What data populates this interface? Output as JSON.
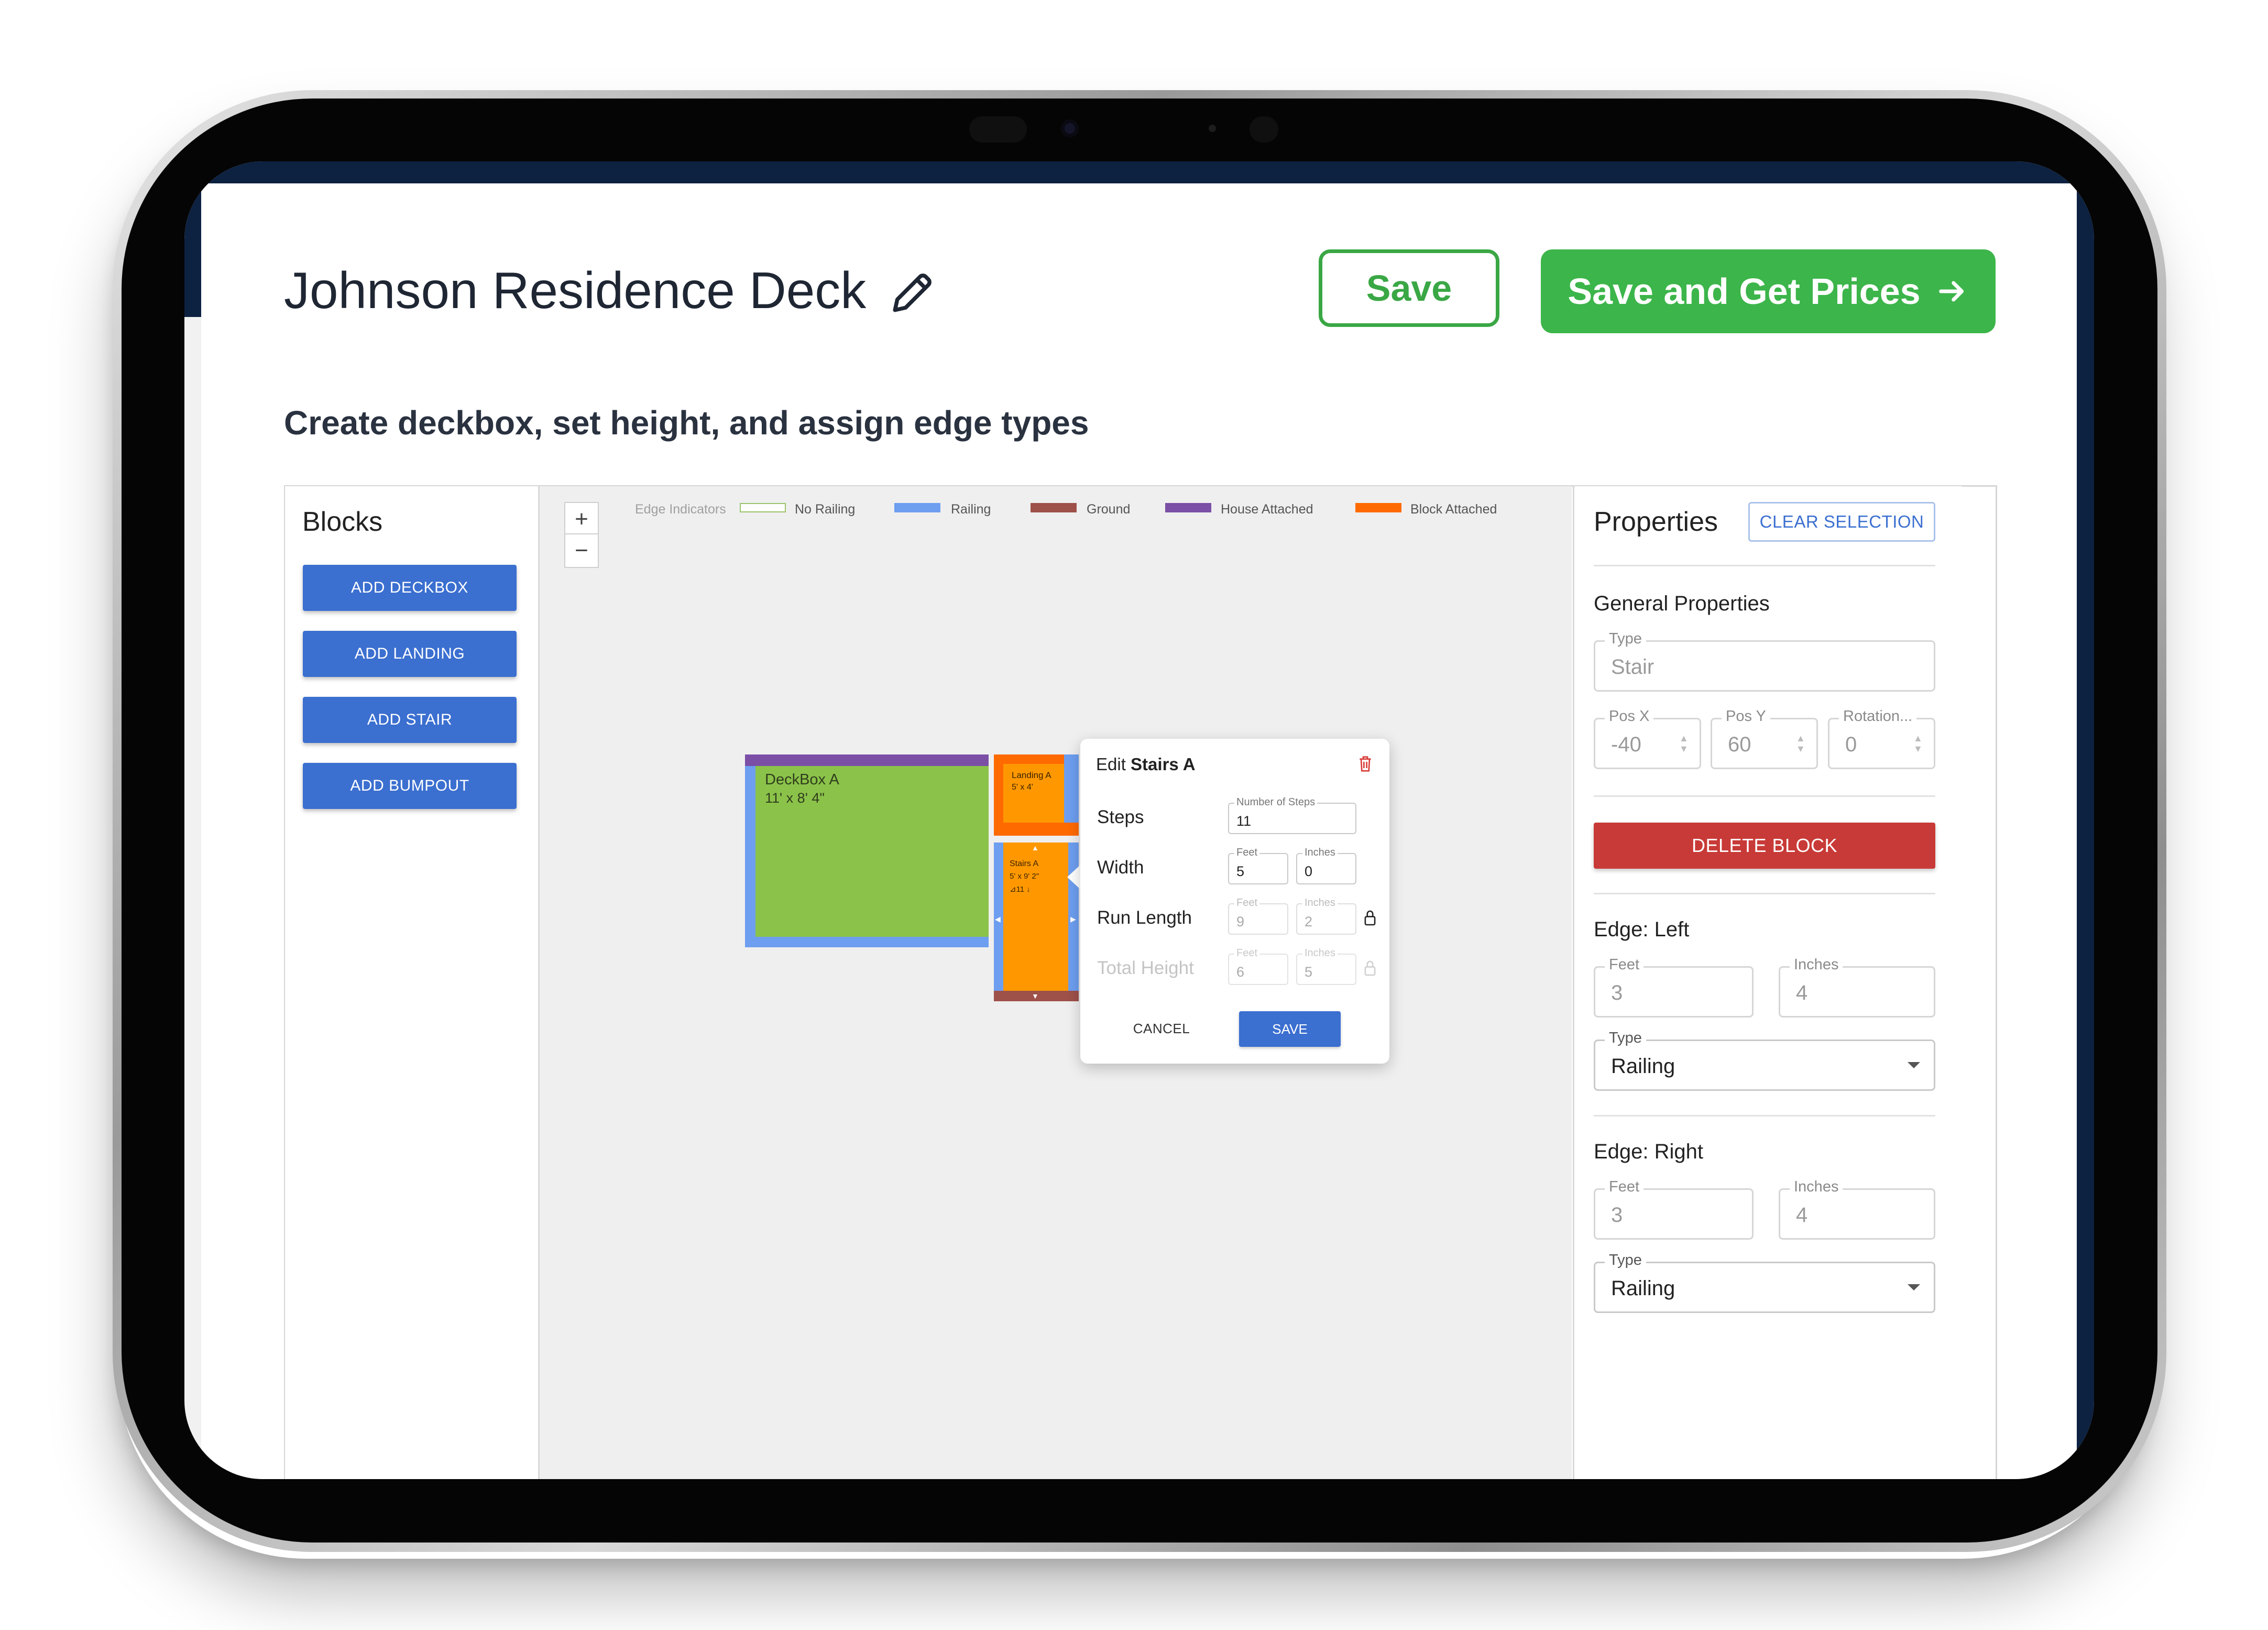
{
  "project": {
    "title": "Johnson Residence Deck"
  },
  "header": {
    "save_label": "Save",
    "save_prices_label": "Save and Get Prices"
  },
  "subtitle": "Create deckbox, set height, and assign edge types",
  "blocks": {
    "title": "Blocks",
    "buttons": [
      "ADD DECKBOX",
      "ADD LANDING",
      "ADD STAIR",
      "ADD BUMPOUT"
    ]
  },
  "canvas": {
    "zoom_in": "+",
    "zoom_out": "−",
    "legend": {
      "title": "Edge Indicators",
      "items": [
        {
          "label": "No Railing",
          "color": "#ffffff",
          "border": "#9bc36b"
        },
        {
          "label": "Railing",
          "color": "#6d9ef0"
        },
        {
          "label": "Ground",
          "color": "#9e5149"
        },
        {
          "label": "House Attached",
          "color": "#7b4fa6"
        },
        {
          "label": "Block Attached",
          "color": "#ff6a00"
        }
      ]
    },
    "deckbox": {
      "name": "DeckBox A",
      "size": "11' x 8' 4\""
    },
    "landing": {
      "name": "Landing A",
      "size": "5' x 4'"
    },
    "stairs": {
      "name": "Stairs A",
      "size": "5' x 9' 2\"",
      "info": "⊿11 ↓"
    }
  },
  "popup": {
    "title_prefix": "Edit",
    "title_name": "Stairs A",
    "steps": {
      "label": "Steps",
      "field_label": "Number of Steps",
      "value": "11"
    },
    "width": {
      "label": "Width",
      "feet_label": "Feet",
      "feet": "5",
      "inches_label": "Inches",
      "inches": "0"
    },
    "run_length": {
      "label": "Run Length",
      "feet_label": "Feet",
      "feet": "9",
      "inches_label": "Inches",
      "inches": "2"
    },
    "total_height": {
      "label": "Total Height",
      "feet_label": "Feet",
      "feet": "6",
      "inches_label": "Inches",
      "inches": "5"
    },
    "cancel": "CANCEL",
    "save": "SAVE"
  },
  "properties": {
    "title": "Properties",
    "clear_selection": "CLEAR SELECTION",
    "general_title": "General Properties",
    "type_label": "Type",
    "type_value": "Stair",
    "pos_x_label": "Pos X",
    "pos_x": "-40",
    "pos_y_label": "Pos Y",
    "pos_y": "60",
    "rotation_label": "Rotation...",
    "rotation": "0",
    "delete_block": "DELETE BLOCK",
    "edge_left": {
      "title": "Edge: Left",
      "feet_label": "Feet",
      "feet": "3",
      "inches_label": "Inches",
      "inches": "4",
      "type_label": "Type",
      "type": "Railing"
    },
    "edge_right": {
      "title": "Edge: Right",
      "feet_label": "Feet",
      "feet": "3",
      "inches_label": "Inches",
      "inches": "4",
      "type_label": "Type",
      "type": "Railing"
    }
  },
  "colors": {
    "brand_green": "#3cb54a",
    "primary_blue": "#3b6fd0",
    "danger_red": "#c83a37",
    "navy": "#0d2141",
    "deck_green": "#8bc34a",
    "stair_orange": "#ff9800"
  }
}
